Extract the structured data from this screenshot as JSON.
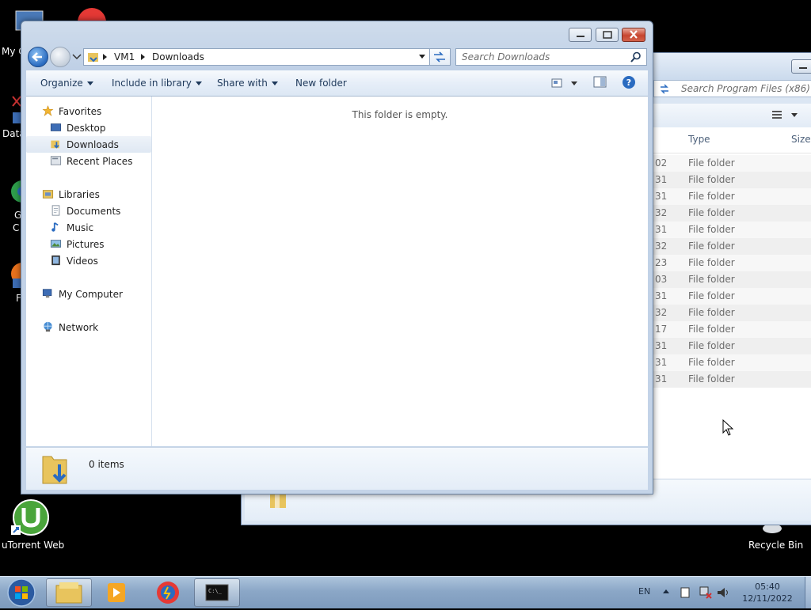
{
  "desktop": {
    "icons": [
      {
        "label": "My C"
      },
      {
        "label": "Data"
      },
      {
        "label": "G"
      },
      {
        "label": "C"
      },
      {
        "label": "F"
      },
      {
        "label": "uTorrent Web"
      },
      {
        "label": "Recycle Bin"
      }
    ]
  },
  "background_window": {
    "search_placeholder": "Search Program Files (x86)",
    "columns": {
      "type": "Type",
      "size": "Size"
    },
    "rows": [
      {
        "date_tail": "02",
        "type": "File folder"
      },
      {
        "date_tail": "31",
        "type": "File folder"
      },
      {
        "date_tail": "31",
        "type": "File folder"
      },
      {
        "date_tail": "32",
        "type": "File folder"
      },
      {
        "date_tail": "31",
        "type": "File folder"
      },
      {
        "date_tail": "32",
        "type": "File folder"
      },
      {
        "date_tail": "23",
        "type": "File folder"
      },
      {
        "date_tail": "03",
        "type": "File folder"
      },
      {
        "date_tail": "31",
        "type": "File folder"
      },
      {
        "date_tail": "32",
        "type": "File folder"
      },
      {
        "date_tail": "17",
        "type": "File folder"
      },
      {
        "date_tail": "31",
        "type": "File folder"
      },
      {
        "date_tail": "31",
        "type": "File folder"
      },
      {
        "date_tail": "31",
        "type": "File folder"
      }
    ]
  },
  "explorer": {
    "breadcrumb": [
      "VM1",
      "Downloads"
    ],
    "search_placeholder": "Search Downloads",
    "toolbar": {
      "organize": "Organize",
      "include_in_library": "Include in library",
      "share_with": "Share with",
      "new_folder": "New folder"
    },
    "nav": {
      "favorites": "Favorites",
      "desktop": "Desktop",
      "downloads": "Downloads",
      "recent_places": "Recent Places",
      "libraries": "Libraries",
      "documents": "Documents",
      "music": "Music",
      "pictures": "Pictures",
      "videos": "Videos",
      "my_computer": "My Computer",
      "network": "Network"
    },
    "empty_message": "This folder is empty.",
    "item_count": "0 items"
  },
  "taskbar": {
    "language": "EN",
    "time": "05:40",
    "date": "12/11/2022"
  },
  "colors": {
    "accent_blue": "#2a6bc0",
    "close_red": "#c7452f",
    "taskbar": "#8ba7c7"
  }
}
